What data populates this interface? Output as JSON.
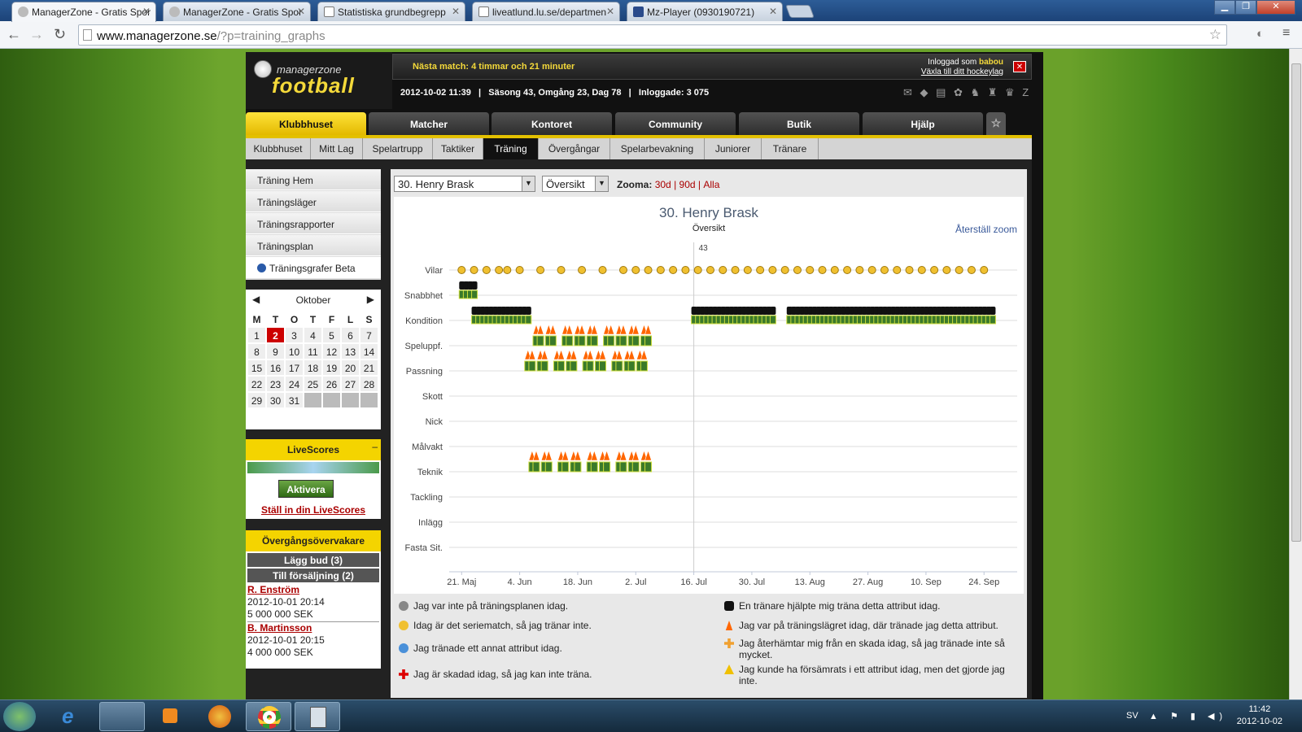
{
  "browser": {
    "tabs": [
      {
        "title": "ManagerZone - Gratis Spor",
        "active": true
      },
      {
        "title": "ManagerZone - Gratis Spor",
        "active": false
      },
      {
        "title": "Statistiska grundbegrepp",
        "active": false
      },
      {
        "title": "liveatlund.lu.se/departmen",
        "active": false
      },
      {
        "title": "Mz-Player (0930190721)",
        "active": false
      }
    ],
    "url_host": "www.managerzone.se",
    "url_path": "/?p=training_graphs"
  },
  "header": {
    "logo_top": "managerzone",
    "logo_bottom": "football",
    "next_match": "Nästa match: 4 timmar och 21 minuter",
    "logged_in_label": "Inloggad som",
    "username": "babou",
    "switch_link": "Växla till ditt hockeylag",
    "close": "✕",
    "info": "2012-10-02 11:39   |   Säsong 43, Omgång 23, Dag 78   |   Inloggade: 3 075",
    "icons": "✉ ◆ ▤ ✿ ♞ ♜ ♛ Z"
  },
  "main_tabs": [
    {
      "label": "Klubbhuset",
      "active": true
    },
    {
      "label": "Matcher",
      "active": false
    },
    {
      "label": "Kontoret",
      "active": false
    },
    {
      "label": "Community",
      "active": false
    },
    {
      "label": "Butik",
      "active": false
    },
    {
      "label": "Hjälp",
      "active": false
    }
  ],
  "star_tab": "☆",
  "sub_tabs": [
    {
      "label": "Klubbhuset",
      "active": false
    },
    {
      "label": "Mitt Lag",
      "active": false
    },
    {
      "label": "Spelartrupp",
      "active": false
    },
    {
      "label": "Taktiker",
      "active": false
    },
    {
      "label": "Träning",
      "active": true
    },
    {
      "label": "Övergångar",
      "active": false
    },
    {
      "label": "Spelarbevakning",
      "active": false
    },
    {
      "label": "Juniorer",
      "active": false
    },
    {
      "label": "Tränare",
      "active": false
    }
  ],
  "left_menu": [
    {
      "label": "Träning Hem",
      "active": false
    },
    {
      "label": "Träningsläger",
      "active": false
    },
    {
      "label": "Träningsrapporter",
      "active": false
    },
    {
      "label": "Träningsplan",
      "active": false
    },
    {
      "label": "Träningsgrafer Beta",
      "active": true
    }
  ],
  "calendar": {
    "month": "Oktober",
    "prev": "◀",
    "next": "▶",
    "days": [
      "M",
      "T",
      "O",
      "T",
      "F",
      "L",
      "S"
    ],
    "dates": [
      "1",
      "2",
      "3",
      "4",
      "5",
      "6",
      "7",
      "8",
      "9",
      "10",
      "11",
      "12",
      "13",
      "14",
      "15",
      "16",
      "17",
      "18",
      "19",
      "20",
      "21",
      "22",
      "23",
      "24",
      "25",
      "26",
      "27",
      "28",
      "29",
      "30",
      "31",
      "",
      "",
      "",
      ""
    ],
    "today": "2"
  },
  "livescores": {
    "title": "LiveScores",
    "minimize": "–",
    "button": "Aktivera",
    "link": "Ställ in din LiveScores"
  },
  "transfers": {
    "title": "Övergångsövervakare",
    "bids": "Lägg bud (3)",
    "for_sale": "Till försäljning (2)",
    "items": [
      {
        "name": "R. Enström",
        "date": "2012-10-01 20:14",
        "price": "5 000 000 SEK"
      },
      {
        "name": "B. Martinsson",
        "date": "2012-10-01 20:15",
        "price": "4 000 000 SEK"
      }
    ]
  },
  "controls": {
    "player": "30. Henry Brask",
    "view": "Översikt",
    "zoom_label": "Zooma:",
    "zoom_30": "30d",
    "zoom_90": "90d",
    "zoom_all": "Alla",
    "sep": "|"
  },
  "chart_data": {
    "type": "scatter",
    "title": "30. Henry Brask",
    "subtitle": "Översikt",
    "reset_zoom": "Återställ zoom",
    "season_marker": "43",
    "season_marker_date": "2012-07-16",
    "categories": [
      "Vilar",
      "Snabbhet",
      "Kondition",
      "Speluppf.",
      "Passning",
      "Skott",
      "Nick",
      "Målvakt",
      "Teknik",
      "Tackling",
      "Inlägg",
      "Fasta Sit."
    ],
    "x_ticks": [
      "21. Maj",
      "4. Jun",
      "18. Jun",
      "2. Jul",
      "16. Jul",
      "30. Jul",
      "13. Aug",
      "27. Aug",
      "10. Sep",
      "24. Sep"
    ],
    "xlim": [
      "2012-05-18",
      "2012-10-02"
    ],
    "colors": {
      "match": "#f0c030",
      "coach": "#111111",
      "camp": "#ff6600",
      "grid": "#dddddd"
    },
    "series": [
      {
        "name": "Vilar",
        "marker": "match-day",
        "dates": [
          "2012-05-21",
          "2012-05-24",
          "2012-05-27",
          "2012-05-30",
          "2012-06-01",
          "2012-06-04",
          "2012-06-09",
          "2012-06-14",
          "2012-06-19",
          "2012-06-24",
          "2012-06-29",
          "2012-07-02",
          "2012-07-05",
          "2012-07-08",
          "2012-07-11",
          "2012-07-14",
          "2012-07-17",
          "2012-07-20",
          "2012-07-23",
          "2012-07-26",
          "2012-07-29",
          "2012-08-01",
          "2012-08-04",
          "2012-08-07",
          "2012-08-10",
          "2012-08-13",
          "2012-08-16",
          "2012-08-19",
          "2012-08-22",
          "2012-08-25",
          "2012-08-28",
          "2012-08-31",
          "2012-09-03",
          "2012-09-06",
          "2012-09-09",
          "2012-09-12",
          "2012-09-15",
          "2012-09-18",
          "2012-09-21",
          "2012-09-24"
        ]
      },
      {
        "name": "Snabbhet",
        "marker": "coach",
        "dates": [
          "2012-05-21",
          "2012-05-22",
          "2012-05-23",
          "2012-05-24"
        ]
      },
      {
        "name": "Kondition",
        "marker": "coach",
        "dates": [
          "2012-05-24",
          "2012-05-25",
          "2012-05-26",
          "2012-05-27",
          "2012-05-28",
          "2012-05-29",
          "2012-05-30",
          "2012-05-31",
          "2012-06-01",
          "2012-06-02",
          "2012-06-03",
          "2012-06-04",
          "2012-06-05",
          "2012-06-06",
          "2012-07-16",
          "2012-07-17",
          "2012-07-18",
          "2012-07-19",
          "2012-07-20",
          "2012-07-21",
          "2012-07-22",
          "2012-07-23",
          "2012-07-24",
          "2012-07-25",
          "2012-07-26",
          "2012-07-27",
          "2012-07-28",
          "2012-07-29",
          "2012-07-30",
          "2012-07-31",
          "2012-08-01",
          "2012-08-02",
          "2012-08-03",
          "2012-08-04",
          "2012-08-08",
          "2012-08-09",
          "2012-08-10",
          "2012-08-11",
          "2012-08-12",
          "2012-08-13",
          "2012-08-14",
          "2012-08-15",
          "2012-08-16",
          "2012-08-17",
          "2012-08-18",
          "2012-08-19",
          "2012-08-20",
          "2012-08-21",
          "2012-08-22",
          "2012-08-23",
          "2012-08-24",
          "2012-08-25",
          "2012-08-26",
          "2012-08-27",
          "2012-08-28",
          "2012-08-29",
          "2012-08-30",
          "2012-08-31",
          "2012-09-01",
          "2012-09-02",
          "2012-09-03",
          "2012-09-04",
          "2012-09-05",
          "2012-09-06",
          "2012-09-07",
          "2012-09-08",
          "2012-09-09",
          "2012-09-10",
          "2012-09-11",
          "2012-09-12",
          "2012-09-13",
          "2012-09-14",
          "2012-09-15",
          "2012-09-16",
          "2012-09-17",
          "2012-09-18",
          "2012-09-19",
          "2012-09-20",
          "2012-09-21",
          "2012-09-22",
          "2012-09-23",
          "2012-09-24",
          "2012-09-25",
          "2012-09-26"
        ]
      },
      {
        "name": "Speluppf.",
        "marker": "camp",
        "dates": [
          "2012-06-08",
          "2012-06-09",
          "2012-06-11",
          "2012-06-12",
          "2012-06-15",
          "2012-06-16",
          "2012-06-18",
          "2012-06-19",
          "2012-06-21",
          "2012-06-22",
          "2012-06-25",
          "2012-06-26",
          "2012-06-28",
          "2012-06-29",
          "2012-07-01",
          "2012-07-02",
          "2012-07-04",
          "2012-07-05"
        ]
      },
      {
        "name": "Passning",
        "marker": "camp",
        "dates": [
          "2012-06-06",
          "2012-06-07",
          "2012-06-09",
          "2012-06-10",
          "2012-06-13",
          "2012-06-14",
          "2012-06-16",
          "2012-06-17",
          "2012-06-20",
          "2012-06-21",
          "2012-06-23",
          "2012-06-24",
          "2012-06-27",
          "2012-06-28",
          "2012-06-30",
          "2012-07-01",
          "2012-07-03",
          "2012-07-04"
        ]
      },
      {
        "name": "Teknik",
        "marker": "camp",
        "dates": [
          "2012-06-07",
          "2012-06-08",
          "2012-06-10",
          "2012-06-11",
          "2012-06-14",
          "2012-06-15",
          "2012-06-17",
          "2012-06-18",
          "2012-06-21",
          "2012-06-22",
          "2012-06-24",
          "2012-06-25",
          "2012-06-28",
          "2012-06-29",
          "2012-07-01",
          "2012-07-02",
          "2012-07-04",
          "2012-07-05"
        ]
      }
    ]
  },
  "legend": [
    {
      "text": "Jag var inte på träningsplanen idag.",
      "icon": "grey-dot-icon",
      "color": "#888888"
    },
    {
      "text": "Idag är det seriematch, så jag tränar inte.",
      "icon": "yellow-dot-icon",
      "color": "#f0c030"
    },
    {
      "text": "Jag tränade ett annat attribut idag.",
      "icon": "blue-dot-icon",
      "color": "#4a90d9"
    },
    {
      "text": "Jag är skadad idag, så jag kan inte träna.",
      "icon": "red-cross-icon",
      "color": "#dd0000"
    },
    {
      "text": "En tränare hjälpte mig träna detta attribut idag.",
      "icon": "coach-icon",
      "color": "#111111"
    },
    {
      "text": "Jag var på träningslägret idag, där tränade jag detta attribut.",
      "icon": "cone-icon",
      "color": "#ff6600"
    },
    {
      "text": "Jag återhämtar mig från en skada idag, så jag tränade inte så mycket.",
      "icon": "orange-cross-icon",
      "color": "#f0a030"
    },
    {
      "text": "Jag kunde ha försämrats i ett attribut idag, men det gjorde jag inte.",
      "icon": "warning-icon",
      "color": "#f0c000"
    }
  ],
  "taskbar": {
    "lang": "SV",
    "time": "11:42",
    "date": "2012-10-02",
    "tray_icons": "▲ ⚑ ▮ ◀)"
  }
}
